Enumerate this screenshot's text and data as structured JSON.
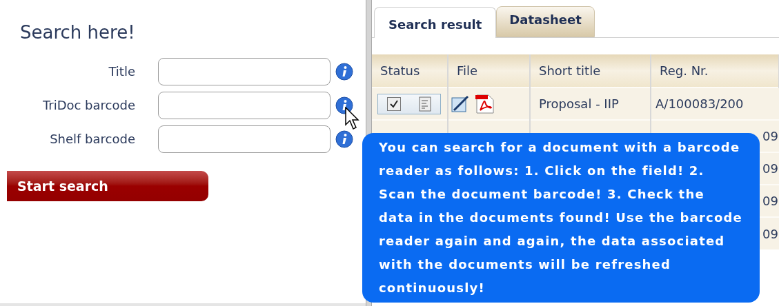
{
  "search_form": {
    "heading": "Search here!",
    "fields": [
      {
        "label": "Title"
      },
      {
        "label": "TriDoc barcode"
      },
      {
        "label": "Shelf barcode"
      }
    ],
    "submit_button": "Start search"
  },
  "tabs": [
    {
      "label": "Search result",
      "selected": true
    },
    {
      "label": "Datasheet",
      "selected": false
    }
  ],
  "table": {
    "columns": [
      "Status",
      "File",
      "Short title",
      "Reg. Nr."
    ],
    "rows": [
      {
        "status_checked": true,
        "short_title": "Proposal - IIP",
        "reg_nr": "A/100083/200"
      },
      {
        "reg_nr": "09"
      },
      {
        "reg_nr": "09"
      },
      {
        "reg_nr": "09"
      },
      {
        "reg_nr": "09"
      }
    ]
  },
  "tooltip": "You can search for a document with a barcode reader as follows: 1. Click on the field! 2. Scan the document barcode! 3. Check the data in the documents found! Use the barcode reader again and again, the data associated with the documents will be refreshed continuously!"
}
